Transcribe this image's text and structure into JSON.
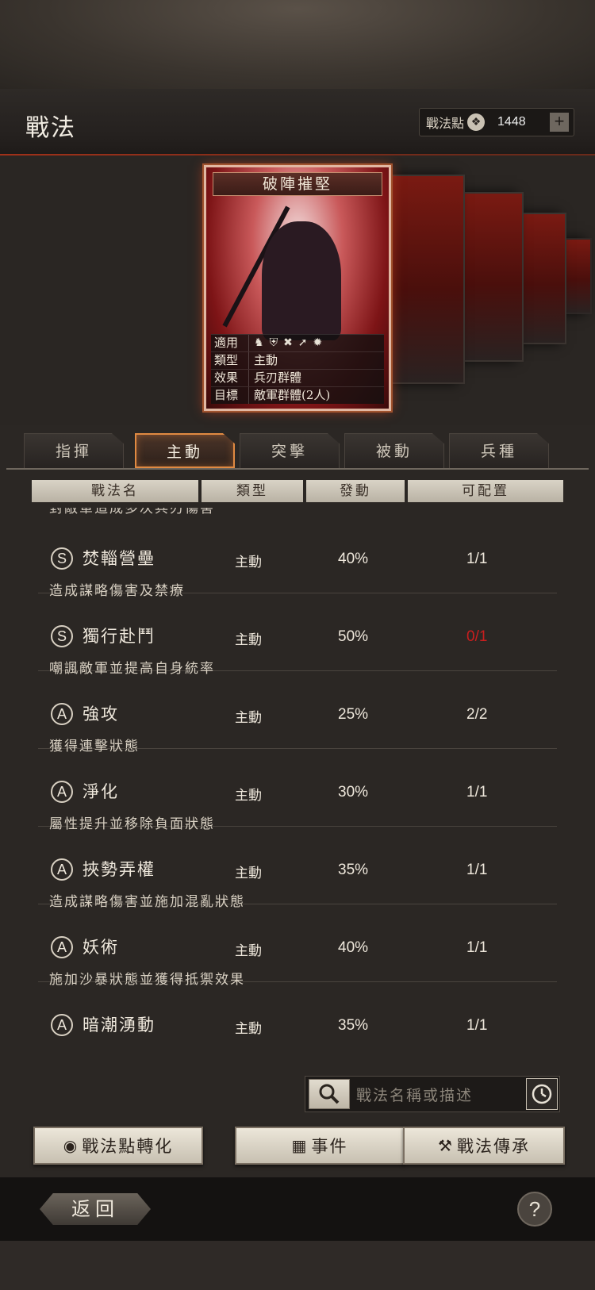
{
  "header": {
    "title": "戰法",
    "points_label": "戰法點",
    "points_value": "1448",
    "points_add": "+"
  },
  "card": {
    "title": "破陣摧堅",
    "info": [
      {
        "key": "適用",
        "value": ""
      },
      {
        "key": "類型",
        "value": "主動"
      },
      {
        "key": "效果",
        "value": "兵刃群體"
      },
      {
        "key": "目標",
        "value": "敵軍群體(2人)"
      }
    ],
    "applicable_icons": [
      "cavalry-icon",
      "shield-icon",
      "bow-icon",
      "spear-icon",
      "wheel-icon"
    ]
  },
  "tabs": [
    {
      "label": "指揮",
      "active": false
    },
    {
      "label": "主動",
      "active": true
    },
    {
      "label": "突擊",
      "active": false
    },
    {
      "label": "被動",
      "active": false
    },
    {
      "label": "兵種",
      "active": false
    }
  ],
  "columns": [
    "戰法名",
    "類型",
    "發動",
    "可配置"
  ],
  "partial_desc": "對敵軍造成多次兵刃傷害",
  "skills": [
    {
      "grade": "S",
      "name": "焚輜營壘",
      "type": "主動",
      "rate": "40%",
      "config": "1/1",
      "desc": "造成謀略傷害及禁療"
    },
    {
      "grade": "S",
      "name": "獨行赴鬥",
      "type": "主動",
      "rate": "50%",
      "config": "0/1",
      "desc": "嘲諷敵軍並提高自身統率"
    },
    {
      "grade": "A",
      "name": "強攻",
      "type": "主動",
      "rate": "25%",
      "config": "2/2",
      "desc": "獲得連擊狀態"
    },
    {
      "grade": "A",
      "name": "淨化",
      "type": "主動",
      "rate": "30%",
      "config": "1/1",
      "desc": "屬性提升並移除負面狀態"
    },
    {
      "grade": "A",
      "name": "挾勢弄權",
      "type": "主動",
      "rate": "35%",
      "config": "1/1",
      "desc": "造成謀略傷害並施加混亂狀態"
    },
    {
      "grade": "A",
      "name": "妖術",
      "type": "主動",
      "rate": "40%",
      "config": "1/1",
      "desc": "施加沙暴狀態並獲得抵禦效果"
    },
    {
      "grade": "A",
      "name": "暗潮湧動",
      "type": "主動",
      "rate": "35%",
      "config": "1/1",
      "desc": ""
    }
  ],
  "search": {
    "placeholder": "戰法名稱或描述"
  },
  "buttons": {
    "convert": "戰法點轉化",
    "event": "事件",
    "inherit": "戰法傳承"
  },
  "footer": {
    "back": "返回",
    "help": "?"
  },
  "colors": {
    "accent": "#e08a42",
    "unavailable": "#c91e1e"
  }
}
